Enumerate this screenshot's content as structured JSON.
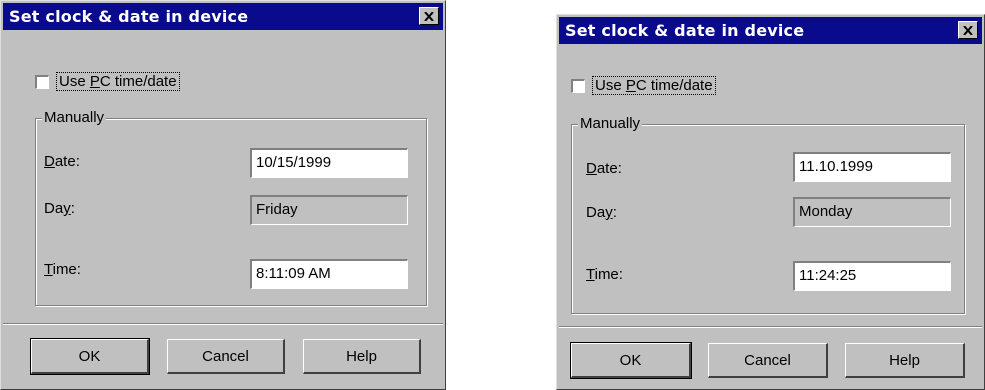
{
  "dialogs": [
    {
      "title": "Set clock & date in device",
      "use_pc": {
        "pre": "Use ",
        "accel": "P",
        "post": "C time/date",
        "checked": false
      },
      "group_label": "Manually",
      "date": {
        "accel": "D",
        "rest": "ate:",
        "value": "10/15/1999"
      },
      "day": {
        "pre": "Da",
        "accel": "y",
        "post": ":",
        "value": "Friday"
      },
      "time": {
        "accel": "T",
        "rest": "ime:",
        "value": "8:11:09  AM"
      },
      "buttons": {
        "ok": "OK",
        "cancel": "Cancel",
        "help": "Help"
      }
    },
    {
      "title": "Set clock & date in device",
      "use_pc": {
        "pre": "Use ",
        "accel": "P",
        "post": "C time/date",
        "checked": false
      },
      "group_label": "Manually",
      "date": {
        "accel": "D",
        "rest": "ate:",
        "value": "11.10.1999"
      },
      "day": {
        "pre": "Da",
        "accel": "y",
        "post": ":",
        "value": "Monday"
      },
      "time": {
        "accel": "T",
        "rest": "ime:",
        "value": "11:24:25"
      },
      "buttons": {
        "ok": "OK",
        "cancel": "Cancel",
        "help": "Help"
      }
    }
  ]
}
